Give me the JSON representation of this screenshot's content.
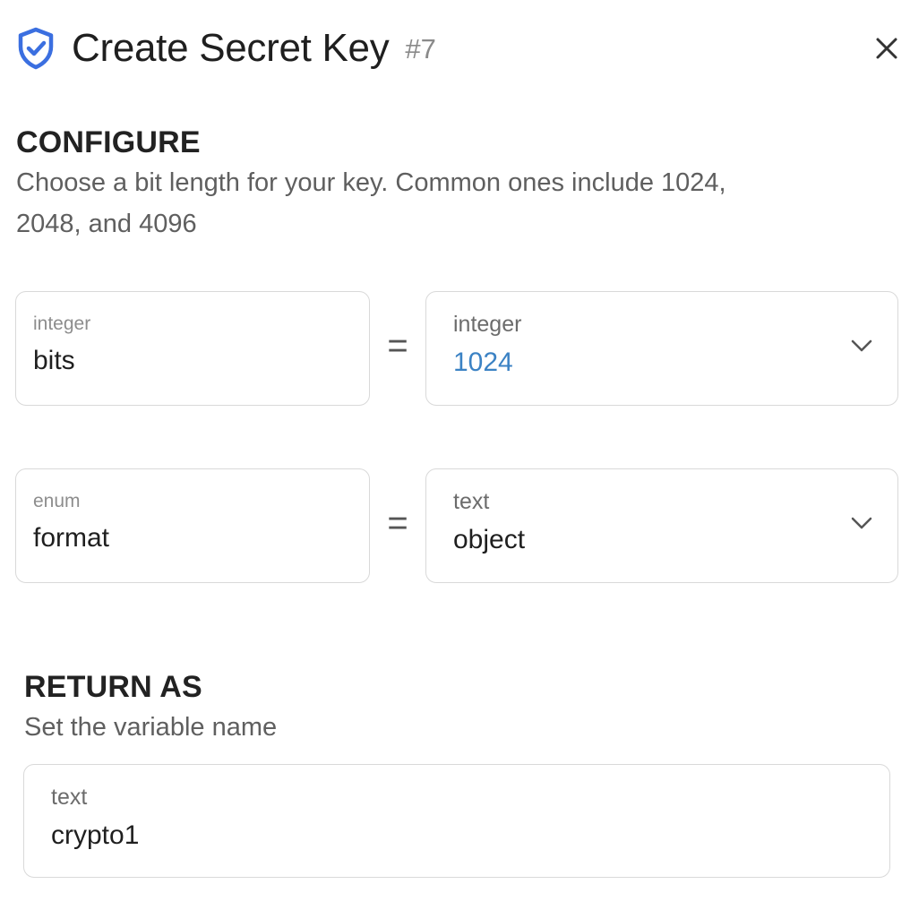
{
  "header": {
    "title": "Create Secret Key",
    "step": "#7",
    "icon": "shield-check-icon",
    "close_icon": "close-icon"
  },
  "configure": {
    "title": "CONFIGURE",
    "description_line1": "Choose a bit length for your key. Common ones include 1024,",
    "description_line2": "2048, and 4096",
    "params": [
      {
        "param_type": "integer",
        "param_name": "bits",
        "operator": "=",
        "value_type": "integer",
        "value": "1024"
      },
      {
        "param_type": "enum",
        "param_name": "format",
        "operator": "=",
        "value_type": "text",
        "value": "object"
      }
    ]
  },
  "return_as": {
    "title": "RETURN AS",
    "description": "Set the variable name",
    "field_type": "text",
    "value": "crypto1"
  },
  "colors": {
    "accent": "#3b6fe0",
    "number_value": "#3b82c4",
    "border": "#d9d9d9"
  }
}
